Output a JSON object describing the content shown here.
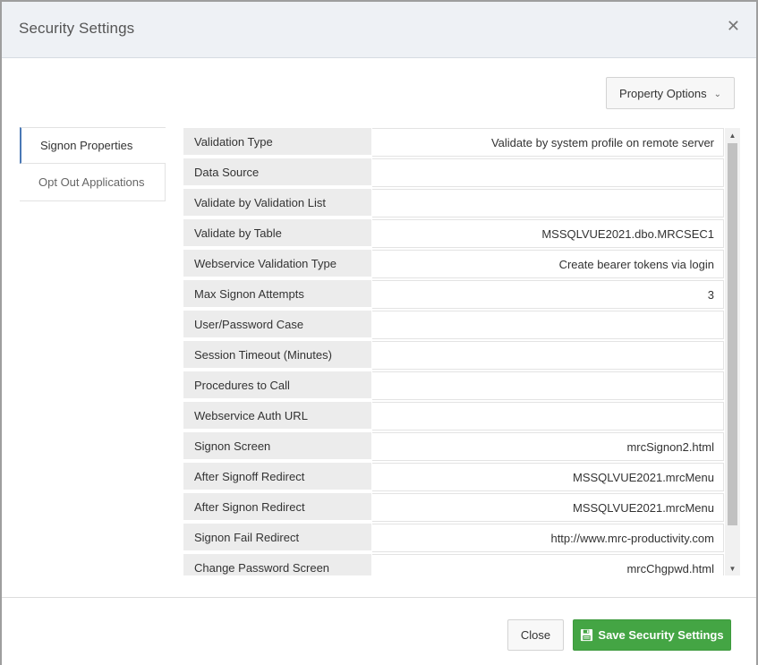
{
  "dialog": {
    "title": "Security Settings",
    "close_icon": "close-icon"
  },
  "toolbar": {
    "property_options_label": "Property Options",
    "chevron_icon": "chevron-down-icon"
  },
  "tabs": [
    {
      "label": "Signon Properties",
      "active": true
    },
    {
      "label": "Opt Out Applications",
      "active": false
    }
  ],
  "properties": [
    {
      "label": "Validation Type",
      "value": "Validate by system profile on remote server"
    },
    {
      "label": "Data Source",
      "value": ""
    },
    {
      "label": "Validate by Validation List",
      "value": ""
    },
    {
      "label": "Validate by Table",
      "value": "MSSQLVUE2021.dbo.MRCSEC1"
    },
    {
      "label": "Webservice Validation Type",
      "value": "Create bearer tokens via login"
    },
    {
      "label": "Max Signon Attempts",
      "value": "3"
    },
    {
      "label": "User/Password Case",
      "value": ""
    },
    {
      "label": "Session Timeout (Minutes)",
      "value": ""
    },
    {
      "label": "Procedures to Call",
      "value": ""
    },
    {
      "label": "Webservice Auth URL",
      "value": ""
    },
    {
      "label": "Signon Screen",
      "value": "mrcSignon2.html"
    },
    {
      "label": "After Signoff Redirect",
      "value": "MSSQLVUE2021.mrcMenu"
    },
    {
      "label": "After Signon Redirect",
      "value": "MSSQLVUE2021.mrcMenu"
    },
    {
      "label": "Signon Fail Redirect",
      "value": "http://www.mrc-productivity.com"
    },
    {
      "label": "Change Password Screen",
      "value": "mrcChgpwd.html"
    }
  ],
  "footer": {
    "close_label": "Close",
    "save_label": "Save Security Settings",
    "save_icon": "floppy-disk-icon"
  },
  "colors": {
    "save_button": "#44a544",
    "active_tab_accent": "#4a78b5",
    "header_bg": "#eef1f5",
    "label_cell_bg": "#ececec"
  }
}
